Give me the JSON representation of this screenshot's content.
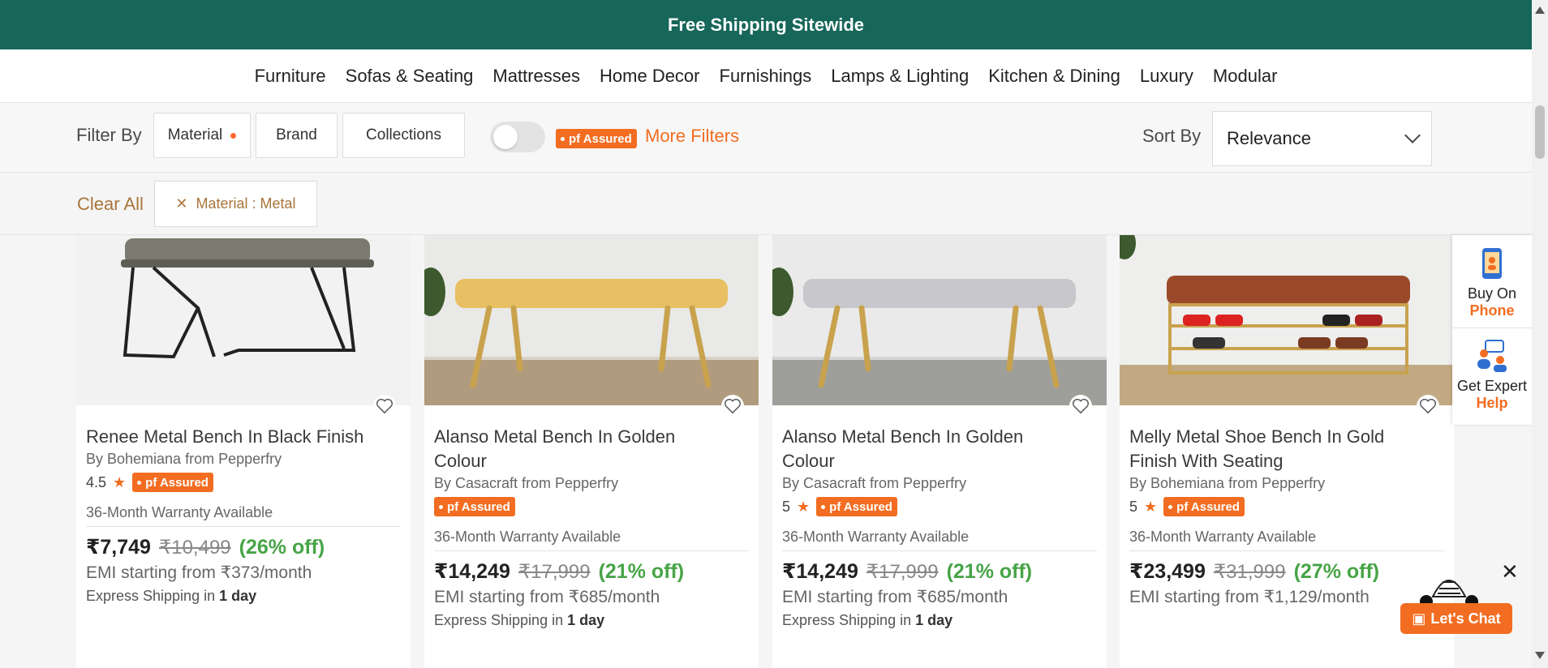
{
  "banner": {
    "text": "Free Shipping Sitewide"
  },
  "nav": {
    "items": [
      "Furniture",
      "Sofas & Seating",
      "Mattresses",
      "Home Decor",
      "Furnishings",
      "Lamps & Lighting",
      "Kitchen & Dining",
      "Luxury",
      "Modular"
    ]
  },
  "filters": {
    "label": "Filter By",
    "chips": [
      "Material",
      "Brand",
      "Collections"
    ],
    "pf_badge": "pf Assured",
    "more": "More Filters",
    "toggle_on": false
  },
  "sort": {
    "label": "Sort By",
    "value": "Relevance"
  },
  "applied": {
    "clear_all": "Clear All",
    "chip": "Material : Metal"
  },
  "products": [
    {
      "title_lines": [
        "Renee Metal Bench In Black Finish"
      ],
      "brand": "By Bohemiana from Pepperfry",
      "rating": "4.5",
      "warranty": "36-Month Warranty Available",
      "price": "₹7,749",
      "mrp": "₹10,499",
      "off": "(26% off)",
      "emi": "EMI starting from ₹373/month",
      "ship_prefix": "Express Shipping in",
      "ship_time": "1 day"
    },
    {
      "title_lines": [
        "Alanso Metal Bench In Golden",
        "Colour"
      ],
      "brand": "By Casacraft from Pepperfry",
      "rating": "",
      "warranty": "36-Month Warranty Available",
      "price": "₹14,249",
      "mrp": "₹17,999",
      "off": "(21% off)",
      "emi": "EMI starting from ₹685/month",
      "ship_prefix": "Express Shipping in",
      "ship_time": "1 day"
    },
    {
      "title_lines": [
        "Alanso Metal Bench In Golden",
        "Colour"
      ],
      "brand": "By Casacraft from Pepperfry",
      "rating": "5",
      "warranty": "36-Month Warranty Available",
      "price": "₹14,249",
      "mrp": "₹17,999",
      "off": "(21% off)",
      "emi": "EMI starting from ₹685/month",
      "ship_prefix": "Express Shipping in",
      "ship_time": "1 day"
    },
    {
      "title_lines": [
        "Melly Metal Shoe Bench In Gold",
        "Finish With Seating"
      ],
      "brand": "By Bohemiana from Pepperfry",
      "rating": "5",
      "warranty": "36-Month Warranty Available",
      "price": "₹23,499",
      "mrp": "₹31,999",
      "off": "(27% off)",
      "emi": "EMI starting from ₹1,129/month",
      "ship_prefix": "",
      "ship_time": ""
    }
  ],
  "side_widget": {
    "buy": {
      "line1": "Buy On",
      "line2": "Phone"
    },
    "expert": {
      "line1": "Get Expert",
      "line2": "Help"
    }
  },
  "chat": {
    "label": "Let's Chat"
  },
  "icons": [
    "chevron-down-icon",
    "close-icon",
    "heart-icon",
    "star-icon",
    "phone-icon",
    "expert-icon",
    "chat-icon",
    "zebra-mascot-icon"
  ],
  "colors": {
    "banner": "#16665a",
    "accent": "#f26d21",
    "discount": "#47a447",
    "clear": "#a9753b"
  }
}
